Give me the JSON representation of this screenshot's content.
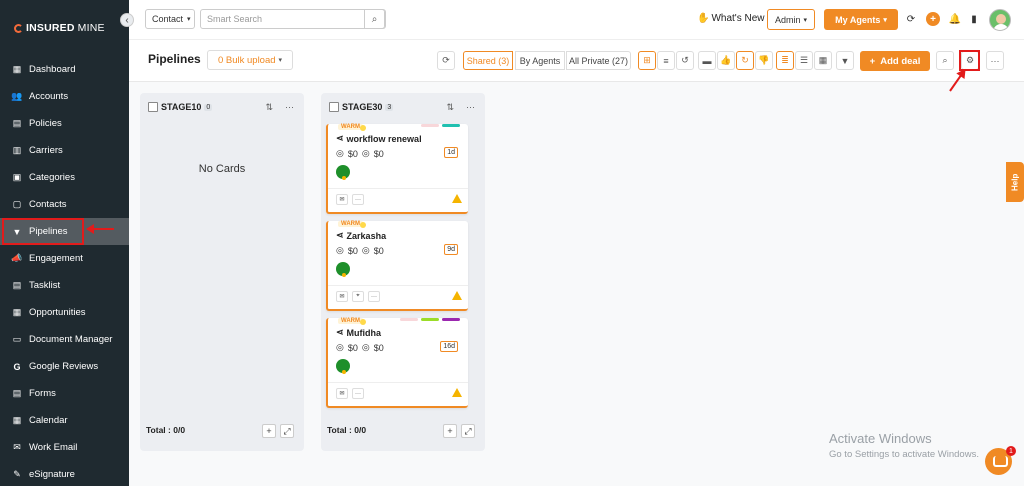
{
  "brand": {
    "part1": "INSURED",
    "part2": "MINE"
  },
  "sidebar": {
    "items": [
      {
        "label": "Dashboard",
        "icon": "dashboard-icon"
      },
      {
        "label": "Accounts",
        "icon": "accounts-icon"
      },
      {
        "label": "Policies",
        "icon": "policies-icon"
      },
      {
        "label": "Carriers",
        "icon": "carriers-icon"
      },
      {
        "label": "Categories",
        "icon": "categories-icon"
      },
      {
        "label": "Contacts",
        "icon": "contacts-icon"
      },
      {
        "label": "Pipelines",
        "icon": "pipelines-icon",
        "active": true
      },
      {
        "label": "Engagement",
        "icon": "engagement-icon"
      },
      {
        "label": "Tasklist",
        "icon": "tasklist-icon"
      },
      {
        "label": "Opportunities",
        "icon": "opportunities-icon"
      },
      {
        "label": "Document Manager",
        "icon": "folder-icon"
      },
      {
        "label": "Google Reviews",
        "icon": "google-icon"
      },
      {
        "label": "Forms",
        "icon": "forms-icon"
      },
      {
        "label": "Calendar",
        "icon": "calendar-icon"
      },
      {
        "label": "Work Email",
        "icon": "email-icon"
      },
      {
        "label": "eSignature",
        "icon": "signature-icon"
      }
    ]
  },
  "topbar": {
    "contact_select": "Contact",
    "search_placeholder": "Smart Search",
    "whats_new": "What's New",
    "admin": "Admin",
    "my_agents": "My Agents"
  },
  "page": {
    "title": "Pipelines",
    "bulk_upload": "0 Bulk upload",
    "shared": "Shared (3)",
    "by_agents": "By Agents",
    "all_private": "All Private (27)",
    "add_deal": "Add deal"
  },
  "columns": [
    {
      "name": "STAGE10",
      "count": "0",
      "empty_text": "No Cards",
      "total": "Total : 0/0",
      "cards": []
    },
    {
      "name": "STAGE30",
      "count": "3",
      "total": "Total : 0/0",
      "cards": [
        {
          "temp": "WARM",
          "name": "workflow renewal",
          "amount1": "$0",
          "amount2": "$0",
          "age": "1d",
          "tags": [
            "#f8d7da",
            "#20c0b0"
          ]
        },
        {
          "temp": "WARM",
          "name": "Zarkasha",
          "amount1": "$0",
          "amount2": "$0",
          "age": "9d",
          "tags": []
        },
        {
          "temp": "WARM",
          "name": "Mufidha",
          "amount1": "$0",
          "amount2": "$0",
          "age": "16d",
          "tags": [
            "#f8d7da",
            "#9bdc28",
            "#9b27af"
          ]
        }
      ]
    }
  ],
  "help": "Help",
  "watermark": {
    "line1": "Activate Windows",
    "line2": "Go to Settings to activate Windows."
  },
  "chat_badge": "1",
  "colors": {
    "accent": "#f08a24",
    "sidebar": "#1f2a30",
    "highlight": "#e21b1b"
  }
}
